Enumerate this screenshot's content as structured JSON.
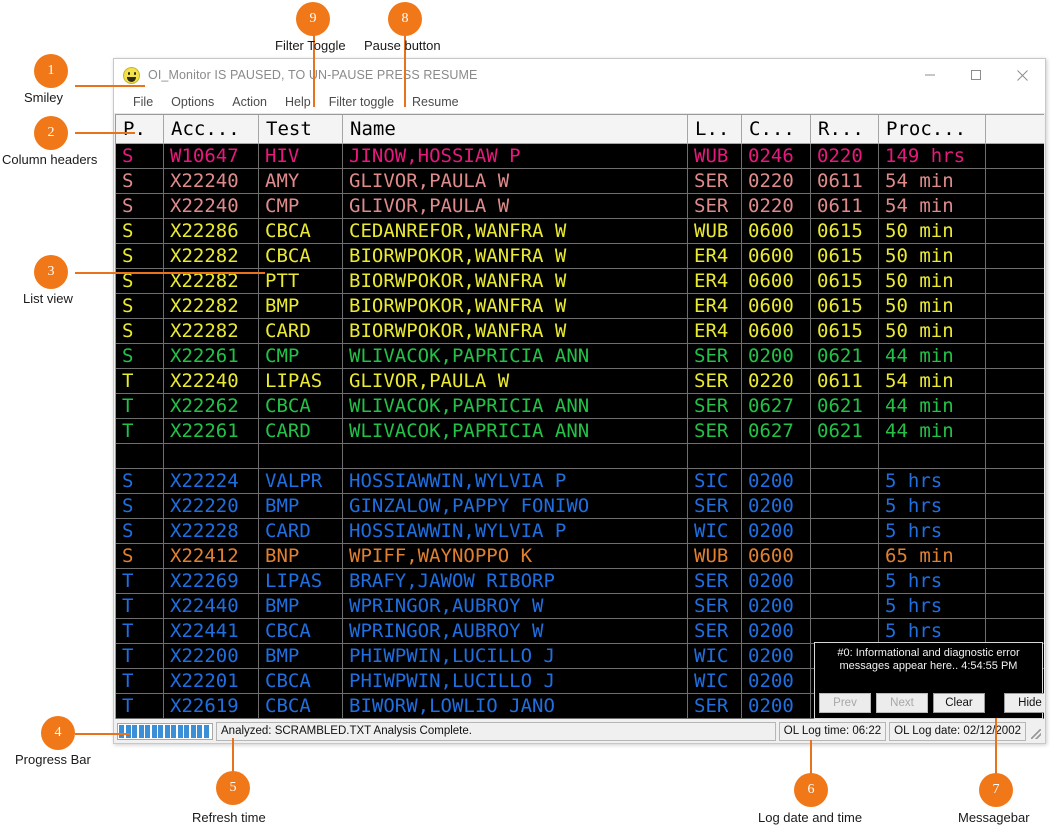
{
  "window": {
    "title": "OI_Monitor IS PAUSED, TO UN-PAUSE PRESS RESUME",
    "smiley_icon": "smiley-icon",
    "minimize_label": "–",
    "maximize_label": "□",
    "close_label": "✕"
  },
  "menu": {
    "items": [
      {
        "label": "File"
      },
      {
        "label": "Options"
      },
      {
        "label": "Action"
      },
      {
        "label": "Help"
      },
      {
        "label": "Filter toggle"
      },
      {
        "label": "Resume"
      }
    ]
  },
  "grid": {
    "headers": [
      "P.",
      "Acc...",
      "Test",
      "Name",
      "L..",
      "C...",
      "R...",
      "Proc...",
      ""
    ],
    "rows": [
      {
        "color": "#e8197d",
        "p": "S",
        "acc": "W10647",
        "test": "HIV",
        "name": "JINOW,HOSSIAW P",
        "loc": "WUB",
        "col": "0246",
        "rep": "0220",
        "proc": "149 hrs"
      },
      {
        "color": "#e08b8b",
        "p": "S",
        "acc": "X22240",
        "test": "AMY",
        "name": "GLIVOR,PAULA W",
        "loc": "SER",
        "col": "0220",
        "rep": "0611",
        "proc": "54 min"
      },
      {
        "color": "#e08b8b",
        "p": "S",
        "acc": "X22240",
        "test": "CMP",
        "name": "GLIVOR,PAULA W",
        "loc": "SER",
        "col": "0220",
        "rep": "0611",
        "proc": "54 min"
      },
      {
        "color": "#eaea32",
        "p": "S",
        "acc": "X22286",
        "test": "CBCA",
        "name": "CEDANREFOR,WANFRA W",
        "loc": "WUB",
        "col": "0600",
        "rep": "0615",
        "proc": "50 min"
      },
      {
        "color": "#eaea32",
        "p": "S",
        "acc": "X22282",
        "test": "CBCA",
        "name": "BIORWPOKOR,WANFRA W",
        "loc": "ER4",
        "col": "0600",
        "rep": "0615",
        "proc": "50 min"
      },
      {
        "color": "#eaea32",
        "p": "S",
        "acc": "X22282",
        "test": "PTT",
        "name": "BIORWPOKOR,WANFRA W",
        "loc": "ER4",
        "col": "0600",
        "rep": "0615",
        "proc": "50 min"
      },
      {
        "color": "#eaea32",
        "p": "S",
        "acc": "X22282",
        "test": "BMP",
        "name": "BIORWPOKOR,WANFRA W",
        "loc": "ER4",
        "col": "0600",
        "rep": "0615",
        "proc": "50 min"
      },
      {
        "color": "#eaea32",
        "p": "S",
        "acc": "X22282",
        "test": "CARD",
        "name": "BIORWPOKOR,WANFRA W",
        "loc": "ER4",
        "col": "0600",
        "rep": "0615",
        "proc": "50 min"
      },
      {
        "color": "#22c248",
        "p": "S",
        "acc": "X22261",
        "test": "CMP",
        "name": "WLIVACOK,PAPRICIA ANN",
        "loc": "SER",
        "col": "0200",
        "rep": "0621",
        "proc": "44 min"
      },
      {
        "color": "#eaea32",
        "p": "T",
        "acc": "X22240",
        "test": "LIPAS",
        "name": "GLIVOR,PAULA W",
        "loc": "SER",
        "col": "0220",
        "rep": "0611",
        "proc": "54 min"
      },
      {
        "color": "#22c248",
        "p": "T",
        "acc": "X22262",
        "test": "CBCA",
        "name": "WLIVACOK,PAPRICIA ANN",
        "loc": "SER",
        "col": "0627",
        "rep": "0621",
        "proc": "44 min"
      },
      {
        "color": "#22c248",
        "p": "T",
        "acc": "X22261",
        "test": "CARD",
        "name": "WLIVACOK,PAPRICIA ANN",
        "loc": "SER",
        "col": "0627",
        "rep": "0621",
        "proc": "44 min"
      },
      {
        "color": "#000000",
        "p": "",
        "acc": "",
        "test": "",
        "name": "",
        "loc": "",
        "col": "",
        "rep": "",
        "proc": ""
      },
      {
        "color": "#1f6fe0",
        "p": "S",
        "acc": "X22224",
        "test": "VALPR",
        "name": "HOSSIAWWIN,WYLVIA P",
        "loc": "SIC",
        "col": "0200",
        "rep": "",
        "proc": "5 hrs"
      },
      {
        "color": "#1f6fe0",
        "p": "S",
        "acc": "X22220",
        "test": "BMP",
        "name": "GINZALOW,PAPPY FONIWO",
        "loc": "SER",
        "col": "0200",
        "rep": "",
        "proc": "5 hrs"
      },
      {
        "color": "#1f6fe0",
        "p": "S",
        "acc": "X22228",
        "test": "CARD",
        "name": "HOSSIAWWIN,WYLVIA P",
        "loc": "WIC",
        "col": "0200",
        "rep": "",
        "proc": "5 hrs"
      },
      {
        "color": "#e08030",
        "p": "S",
        "acc": "X22412",
        "test": "BNP",
        "name": "WPIFF,WAYNOPPO K",
        "loc": "WUB",
        "col": "0600",
        "rep": "",
        "proc": "65 min"
      },
      {
        "color": "#1f6fe0",
        "p": "T",
        "acc": "X22269",
        "test": "LIPAS",
        "name": "BRAFY,JAWOW RIBORP",
        "loc": "SER",
        "col": "0200",
        "rep": "",
        "proc": "5 hrs"
      },
      {
        "color": "#1f6fe0",
        "p": "T",
        "acc": "X22440",
        "test": "BMP",
        "name": "WPRINGOR,AUBROY W",
        "loc": "SER",
        "col": "0200",
        "rep": "",
        "proc": "5 hrs"
      },
      {
        "color": "#1f6fe0",
        "p": "T",
        "acc": "X22441",
        "test": "CBCA",
        "name": "WPRINGOR,AUBROY W",
        "loc": "SER",
        "col": "0200",
        "rep": "",
        "proc": "5 hrs"
      },
      {
        "color": "#1f6fe0",
        "p": "T",
        "acc": "X22200",
        "test": "BMP",
        "name": "PHIWPWIN,LUCILLO J",
        "loc": "WIC",
        "col": "0200",
        "rep": "",
        "proc": ""
      },
      {
        "color": "#1f6fe0",
        "p": "T",
        "acc": "X22201",
        "test": "CBCA",
        "name": "PHIWPWIN,LUCILLO J",
        "loc": "WIC",
        "col": "0200",
        "rep": "",
        "proc": ""
      },
      {
        "color": "#1f6fe0",
        "p": "T",
        "acc": "X22619",
        "test": "CBCA",
        "name": "BIWORW,LOWLIO JANO",
        "loc": "SER",
        "col": "0200",
        "rep": "",
        "proc": ""
      }
    ]
  },
  "messagebar": {
    "text": "#0: Informational and diagnostic error messages appear here..  4:54:55 PM",
    "buttons": [
      {
        "label": "Prev",
        "disabled": true
      },
      {
        "label": "Next",
        "disabled": true
      },
      {
        "label": "Clear",
        "disabled": false
      },
      {
        "label": "Hide",
        "disabled": false
      }
    ]
  },
  "statusbar": {
    "progress_chunks": 14,
    "progress_color": "#3a8fd6",
    "refresh_text": "Analyzed: SCRAMBLED.TXT Analysis Complete.",
    "log_time": "OL Log time: 06:22",
    "log_date": "OL Log date: 02/12/2002"
  },
  "annotations": {
    "accent_color": "#f07818",
    "items": [
      {
        "number": "1",
        "label": "Smiley"
      },
      {
        "number": "2",
        "label": "Column headers"
      },
      {
        "number": "3",
        "label": "List view"
      },
      {
        "number": "4",
        "label": "Progress Bar"
      },
      {
        "number": "5",
        "label": "Refresh time"
      },
      {
        "number": "6",
        "label": "Log date and time"
      },
      {
        "number": "7",
        "label": "Messagebar"
      },
      {
        "number": "8",
        "label": "Pause button"
      },
      {
        "number": "9",
        "label": "Filter Toggle"
      }
    ]
  }
}
